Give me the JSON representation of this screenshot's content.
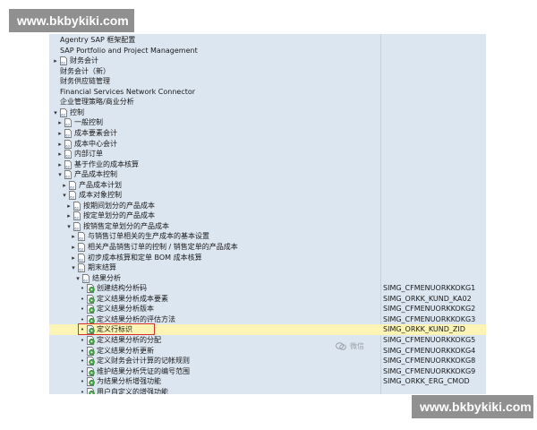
{
  "watermark_top": "www.bkbykiki.com",
  "watermark_bottom": "www.bkbykiki.com",
  "wechat_label": "微信",
  "tree": [
    {
      "level": 1,
      "expand": "",
      "icon": "none",
      "label": "Agentry SAP 框架配置",
      "code": ""
    },
    {
      "level": 1,
      "expand": "",
      "icon": "none",
      "label": "SAP Portfolio and Project Management",
      "code": ""
    },
    {
      "level": 1,
      "expand": "collapsed",
      "icon": "doc",
      "label": "财务会计",
      "code": ""
    },
    {
      "level": 1,
      "expand": "",
      "icon": "none",
      "label": "财务会计（新）",
      "code": ""
    },
    {
      "level": 1,
      "expand": "",
      "icon": "none",
      "label": "财务供应链管理",
      "code": ""
    },
    {
      "level": 1,
      "expand": "",
      "icon": "none",
      "label": "Financial Services Network Connector",
      "code": ""
    },
    {
      "level": 1,
      "expand": "",
      "icon": "none",
      "label": "企业管理策略/商业分析",
      "code": ""
    },
    {
      "level": 1,
      "expand": "expanded",
      "icon": "doc",
      "label": "控制",
      "code": ""
    },
    {
      "level": 2,
      "expand": "collapsed",
      "icon": "doc",
      "label": "一般控制",
      "code": ""
    },
    {
      "level": 2,
      "expand": "collapsed",
      "icon": "doc",
      "label": "成本要素会计",
      "code": ""
    },
    {
      "level": 2,
      "expand": "collapsed",
      "icon": "doc",
      "label": "成本中心会计",
      "code": ""
    },
    {
      "level": 2,
      "expand": "collapsed",
      "icon": "doc",
      "label": "内部订单",
      "code": ""
    },
    {
      "level": 2,
      "expand": "collapsed",
      "icon": "doc",
      "label": "基于作业的成本核算",
      "code": ""
    },
    {
      "level": 2,
      "expand": "expanded",
      "icon": "doc",
      "label": "产品成本控制",
      "code": ""
    },
    {
      "level": 3,
      "expand": "collapsed",
      "icon": "doc",
      "label": "产品成本计划",
      "code": ""
    },
    {
      "level": 3,
      "expand": "expanded",
      "icon": "doc",
      "label": "成本对象控制",
      "code": ""
    },
    {
      "level": 4,
      "expand": "collapsed",
      "icon": "doc",
      "label": "按期间划分的产品成本",
      "code": ""
    },
    {
      "level": 4,
      "expand": "collapsed",
      "icon": "doc",
      "label": "按定单划分的产品成本",
      "code": ""
    },
    {
      "level": 4,
      "expand": "expanded",
      "icon": "doc",
      "label": "按销售定单划分的产品成本",
      "code": ""
    },
    {
      "level": 5,
      "expand": "collapsed",
      "icon": "doc",
      "label": "与销售订单相关的生产成本的基本设置",
      "code": ""
    },
    {
      "level": 5,
      "expand": "collapsed",
      "icon": "doc",
      "label": "相关产品销售订单的控制 / 销售定单的产品成本",
      "code": ""
    },
    {
      "level": 5,
      "expand": "collapsed",
      "icon": "doc",
      "label": "初步成本核算和定单 BOM 成本核算",
      "code": ""
    },
    {
      "level": 5,
      "expand": "expanded",
      "icon": "doc",
      "label": "期末结算",
      "code": ""
    },
    {
      "level": 6,
      "expand": "expanded",
      "icon": "doc",
      "label": "结果分析",
      "code": ""
    },
    {
      "level": 7,
      "expand": "leaf",
      "icon": "exec",
      "label": "创建结构分析码",
      "code": "SIMG_CFMENUORKKOKG1"
    },
    {
      "level": 7,
      "expand": "leaf",
      "icon": "exec",
      "label": "定义结果分析成本要素",
      "code": "SIMG_ORKK_KUND_KA02"
    },
    {
      "level": 7,
      "expand": "leaf",
      "icon": "exec",
      "label": "定义结果分析版本",
      "code": "SIMG_CFMENUORKKOKG2"
    },
    {
      "level": 7,
      "expand": "leaf",
      "icon": "exec",
      "label": "定义结果分析的评估方法",
      "code": "SIMG_CFMENUORKKOKG3"
    },
    {
      "level": 7,
      "expand": "leaf",
      "icon": "exec",
      "label": "定义行标识",
      "code": "SIMG_ORKK_KUND_ZID",
      "highlight": true
    },
    {
      "level": 7,
      "expand": "leaf",
      "icon": "exec",
      "label": "定义结果分析的分配",
      "code": "SIMG_CFMENUORKKOKG5"
    },
    {
      "level": 7,
      "expand": "leaf",
      "icon": "exec",
      "label": "定义结果分析更新",
      "code": "SIMG_CFMENUORKKOKG4"
    },
    {
      "level": 7,
      "expand": "leaf",
      "icon": "exec",
      "label": "定义财务会计计算的记帐规则",
      "code": "SIMG_CFMENUORKKOKG8"
    },
    {
      "level": 7,
      "expand": "leaf",
      "icon": "exec",
      "label": "维护结果分析凭证的编号范围",
      "code": "SIMG_CFMENUORKKOKG9"
    },
    {
      "level": 7,
      "expand": "leaf",
      "icon": "exec",
      "label": "为结果分析增强功能",
      "code": "SIMG_ORKK_ERG_CMOD"
    },
    {
      "level": 7,
      "expand": "leaf",
      "icon": "exec",
      "label": "用户自定义的增强功能",
      "code": ""
    }
  ]
}
